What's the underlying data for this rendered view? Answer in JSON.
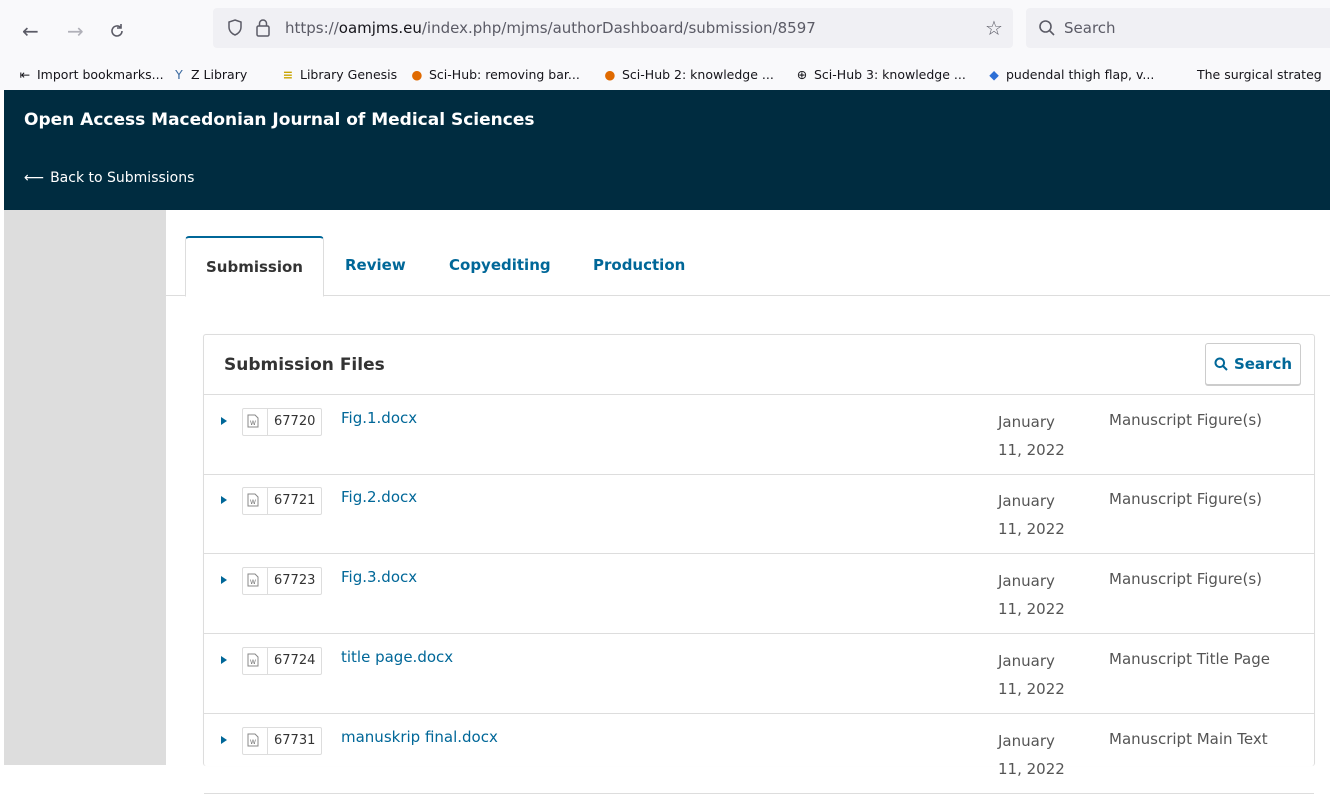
{
  "browser": {
    "back_icon": "arrow-left-icon",
    "forward_icon": "arrow-right-icon",
    "reload_icon": "reload-icon",
    "url_prefix": "https://",
    "url_domain": "oamjms.eu",
    "url_path": "/index.php/mjms/authorDashboard/submission/8597",
    "search_placeholder": "Search"
  },
  "bookmarks": [
    {
      "label": "Import bookmarks...",
      "icon": "import-icon"
    },
    {
      "label": "Z Library",
      "icon": "zlibrary-icon"
    },
    {
      "label": "Library Genesis",
      "icon": "libgen-icon"
    },
    {
      "label": "Sci-Hub: removing bar...",
      "icon": "scihub-icon"
    },
    {
      "label": "Sci-Hub 2: knowledge ...",
      "icon": "scihub-icon"
    },
    {
      "label": "Sci-Hub 3: knowledge ...",
      "icon": "globe-icon"
    },
    {
      "label": "pudendal thigh flap, v...",
      "icon": "diamond-icon"
    },
    {
      "label": "The surgical strateg",
      "icon": "blank-icon"
    }
  ],
  "header": {
    "journal_title": "Open Access Macedonian Journal of Medical Sciences",
    "back_link": "Back to Submissions"
  },
  "tabs": [
    {
      "label": "Submission",
      "active": true
    },
    {
      "label": "Review",
      "active": false
    },
    {
      "label": "Copyediting",
      "active": false
    },
    {
      "label": "Production",
      "active": false
    }
  ],
  "files_panel": {
    "title": "Submission Files",
    "search_label": "Search",
    "rows": [
      {
        "id": "67720",
        "name": "Fig.1.docx",
        "date_line1": "January",
        "date_line2": "11, 2022",
        "type": "Manuscript Figure(s)"
      },
      {
        "id": "67721",
        "name": "Fig.2.docx",
        "date_line1": "January",
        "date_line2": "11, 2022",
        "type": "Manuscript Figure(s)"
      },
      {
        "id": "67723",
        "name": "Fig.3.docx",
        "date_line1": "January",
        "date_line2": "11, 2022",
        "type": "Manuscript Figure(s)"
      },
      {
        "id": "67724",
        "name": "title page.docx",
        "date_line1": "January",
        "date_line2": "11, 2022",
        "type": "Manuscript Title Page"
      },
      {
        "id": "67731",
        "name": "manuskrip final.docx",
        "date_line1": "January",
        "date_line2": "11, 2022",
        "type": "Manuscript Main Text"
      }
    ]
  },
  "colors": {
    "header_bg": "#002c40",
    "link": "#006798",
    "sidebar": "#dddddd"
  }
}
